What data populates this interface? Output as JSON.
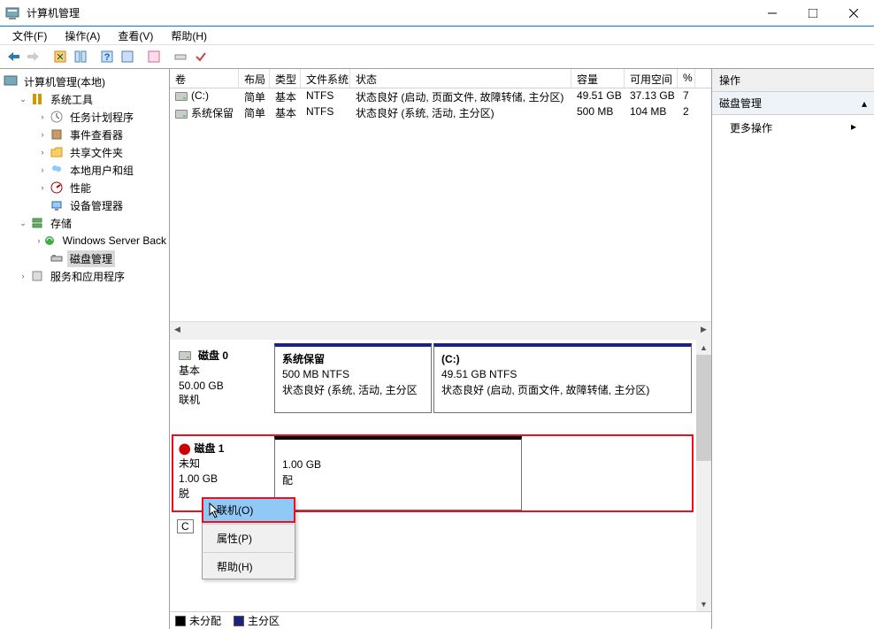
{
  "titlebar": {
    "title": "计算机管理"
  },
  "menubar": [
    "文件(F)",
    "操作(A)",
    "查看(V)",
    "帮助(H)"
  ],
  "tree": {
    "root": "计算机管理(本地)",
    "sys_tools": "系统工具",
    "task_sched": "任务计划程序",
    "event_viewer": "事件查看器",
    "shared": "共享文件夹",
    "users": "本地用户和组",
    "perf": "性能",
    "devmgr": "设备管理器",
    "storage": "存储",
    "wsb": "Windows Server Back",
    "diskmgmt": "磁盘管理",
    "services": "服务和应用程序"
  },
  "vol_headers": {
    "vol": "卷",
    "layout": "布局",
    "type": "类型",
    "fs": "文件系统",
    "status": "状态",
    "capacity": "容量",
    "free": "可用空间",
    "pct": "%"
  },
  "volumes": [
    {
      "name": "(C:)",
      "layout": "简单",
      "type": "基本",
      "fs": "NTFS",
      "status": "状态良好 (启动, 页面文件, 故障转储, 主分区)",
      "cap": "49.51 GB",
      "free": "37.13 GB",
      "pct": "7"
    },
    {
      "name": "系统保留",
      "layout": "简单",
      "type": "基本",
      "fs": "NTFS",
      "status": "状态良好 (系统, 活动, 主分区)",
      "cap": "500 MB",
      "free": "104 MB",
      "pct": "2"
    }
  ],
  "disk0": {
    "title": "磁盘 0",
    "type": "基本",
    "size": "50.00 GB",
    "state": "联机",
    "p1": {
      "name": "系统保留",
      "size": "500 MB NTFS",
      "status": "状态良好 (系统, 活动, 主分区"
    },
    "p2": {
      "name": "(C:)",
      "size": "49.51 GB NTFS",
      "status": "状态良好 (启动, 页面文件, 故障转储, 主分区)"
    }
  },
  "disk1": {
    "title": "磁盘 1",
    "type": "未知",
    "size": "1.00 GB",
    "state": "脱",
    "p1": {
      "size": "1.00 GB",
      "status": "配"
    }
  },
  "legend": {
    "unalloc": "未分配",
    "primary": "主分区"
  },
  "ctx_menu": {
    "online": "联机(O)",
    "props": "属性(P)",
    "help": "帮助(H)"
  },
  "actions": {
    "header": "操作",
    "section": "磁盘管理",
    "more": "更多操作"
  }
}
